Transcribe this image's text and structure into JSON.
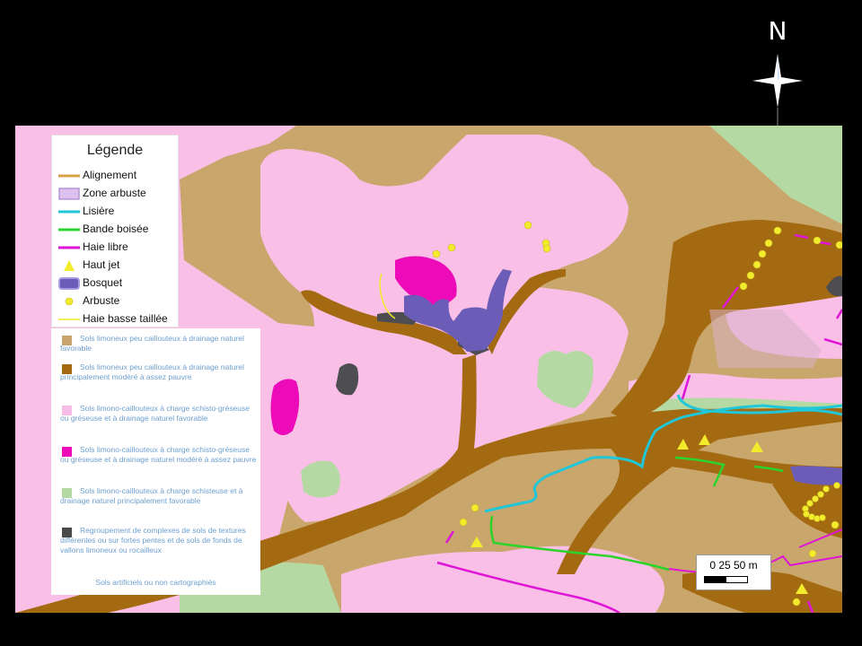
{
  "north_arrow": {
    "letter": "N",
    "icon": "compass-star-icon"
  },
  "legend": {
    "title": "Légende",
    "items": [
      {
        "label": "Alignement",
        "symbol": "line",
        "color": "#d7a047"
      },
      {
        "label": "Zone arbuste",
        "symbol": "box",
        "color": "#c9a7e6"
      },
      {
        "label": "Lisière",
        "symbol": "line",
        "color": "#1fc7d9"
      },
      {
        "label": "Bande boisée",
        "symbol": "line",
        "color": "#2bd42b"
      },
      {
        "label": "Haie libre",
        "symbol": "line",
        "color": "#e014d6"
      },
      {
        "label": "Haut jet",
        "symbol": "triangle",
        "color": "#f2ec2c"
      },
      {
        "label": "Bosquet",
        "symbol": "box",
        "color": "#6b5cb8"
      },
      {
        "label": "Arbuste",
        "symbol": "dot",
        "color": "#f2ec2c"
      },
      {
        "label": "Haie basse taillée",
        "symbol": "line",
        "color": "#f2ec2c"
      }
    ]
  },
  "soil_legend": {
    "items": [
      {
        "label": "Sols limoneux peu caillouteux à drainage naturel favorable",
        "color": "#c9a36c"
      },
      {
        "label": "Sols limoneux peu caillouteux à drainage naturel principalement modéré à assez pauvre",
        "color": "#a46a12"
      },
      {
        "label": "Sols limono-caillouteux à charge schisto-gréseuse ou gréseuse et à drainage naturel favorable",
        "color": "#f8bde6"
      },
      {
        "label": "Sols limono-caillouteux à charge schisto-gréseuse ou gréseuse et à drainage naturel modéré à assez pauvre",
        "color": "#ec0ab9"
      },
      {
        "label": "Sols limono-caillouteux à charge schisteuse et à drainage naturel principalement favorable",
        "color": "#b4d9a2"
      },
      {
        "label": "Regroupement de complexes de sols de textures différentes ou sur fortes pentes et de sols de fonds de vallons limoneux ou rocailleux",
        "color": "#4a4a4a"
      },
      {
        "label": "Sols artificiels ou non cartographiés",
        "color": ""
      }
    ]
  },
  "scale_bar": {
    "label": "0   25  50 m"
  },
  "map": {
    "colors": {
      "tan": "#c9a66b",
      "brown": "#a46a12",
      "pink": "#f9bfe6",
      "magenta": "#ec0ab9",
      "green": "#b4d9a2",
      "dark": "#4d4d52",
      "bosquet": "#6b5cb8"
    }
  }
}
